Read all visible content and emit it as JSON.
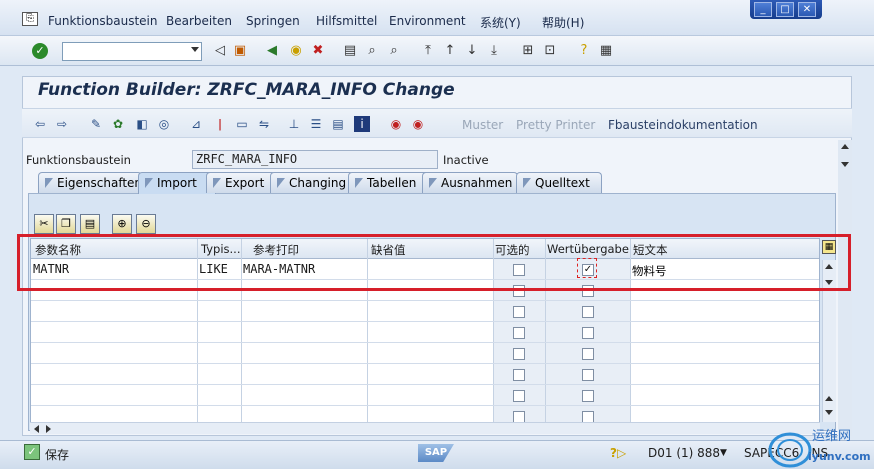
{
  "menubar": {
    "items": [
      "Funktionsbaustein",
      "Bearbeiten",
      "Springen",
      "Hilfsmittel",
      "Environment",
      "系统(Y)",
      "帮助(H)"
    ]
  },
  "window_buttons": [
    "_",
    "□",
    "✕"
  ],
  "toolbar": {
    "command_field_value": ""
  },
  "screen": {
    "title": "Function Builder: ZRFC_MARA_INFO Change"
  },
  "app_toolbar": {
    "muster_label": "Muster",
    "pretty_printer_label": "Pretty Printer",
    "fb_doc_label": "Fbausteindokumentation"
  },
  "header": {
    "fb_label": "Funktionsbaustein",
    "fb_value": "ZRFC_MARA_INFO",
    "status": "Inactive"
  },
  "tabs": [
    "Eigenschaften",
    "Import",
    "Export",
    "Changing",
    "Tabellen",
    "Ausnahmen",
    "Quelltext"
  ],
  "active_tab": "Import",
  "table": {
    "columns": [
      "参数名称",
      "Typis...",
      "参考打印",
      "缺省值",
      "可选的",
      "Wertübergabe",
      "短文本"
    ],
    "rows": [
      {
        "param": "MATNR",
        "typing": "LIKE",
        "ref": "MARA-MATNR",
        "default": "",
        "optional": false,
        "pass_by_value": true,
        "short_text": "物料号"
      }
    ],
    "empty_rows": 7
  },
  "statusbar": {
    "save_label": "保存",
    "session": "D01 (1) 888",
    "server": "SAPECC6",
    "mode": "INS"
  },
  "watermark": {
    "text": "运维网",
    "sub": "iyunv.com"
  },
  "colors": {
    "highlight": "#d61f2a",
    "title_text": "#1b2f50"
  }
}
